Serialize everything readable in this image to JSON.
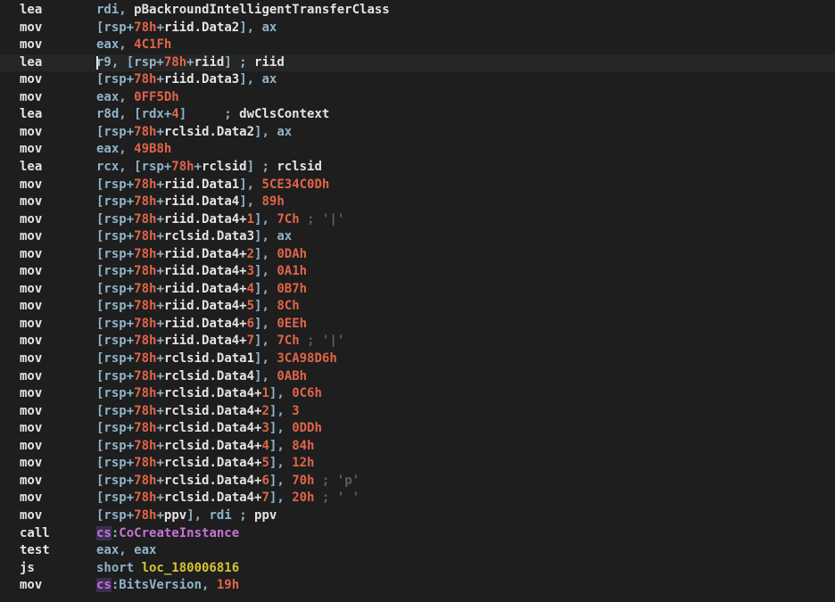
{
  "lines": [
    {
      "mnemonic": "lea",
      "tokens": [
        {
          "c": "plain",
          "t": "rdi, "
        },
        {
          "c": "white",
          "t": "pBackroundIntelligentTransferClass"
        }
      ]
    },
    {
      "mnemonic": "mov",
      "tokens": [
        {
          "c": "plain",
          "t": "[rsp+"
        },
        {
          "c": "num",
          "t": "78h"
        },
        {
          "c": "plain",
          "t": "+"
        },
        {
          "c": "white",
          "t": "riid.Data2"
        },
        {
          "c": "plain",
          "t": "], ax"
        }
      ]
    },
    {
      "mnemonic": "mov",
      "tokens": [
        {
          "c": "plain",
          "t": "eax, "
        },
        {
          "c": "num",
          "t": "4C1Fh"
        }
      ]
    },
    {
      "mnemonic": "lea",
      "active": true,
      "tokens": [
        {
          "c": "plain",
          "t": "r9, [rsp+"
        },
        {
          "c": "num",
          "t": "78h"
        },
        {
          "c": "plain",
          "t": "+"
        },
        {
          "c": "white",
          "t": "riid"
        },
        {
          "c": "plain",
          "t": "] ; "
        },
        {
          "c": "white",
          "t": "riid"
        }
      ]
    },
    {
      "mnemonic": "mov",
      "tokens": [
        {
          "c": "plain",
          "t": "[rsp+"
        },
        {
          "c": "num",
          "t": "78h"
        },
        {
          "c": "plain",
          "t": "+"
        },
        {
          "c": "white",
          "t": "riid.Data3"
        },
        {
          "c": "plain",
          "t": "], ax"
        }
      ]
    },
    {
      "mnemonic": "mov",
      "tokens": [
        {
          "c": "plain",
          "t": "eax, "
        },
        {
          "c": "num",
          "t": "0FF5Dh"
        }
      ]
    },
    {
      "mnemonic": "lea",
      "tokens": [
        {
          "c": "plain",
          "t": "r8d, [rdx+"
        },
        {
          "c": "num",
          "t": "4"
        },
        {
          "c": "plain",
          "t": "]     ; "
        },
        {
          "c": "white",
          "t": "dwClsContext"
        }
      ]
    },
    {
      "mnemonic": "mov",
      "tokens": [
        {
          "c": "plain",
          "t": "[rsp+"
        },
        {
          "c": "num",
          "t": "78h"
        },
        {
          "c": "plain",
          "t": "+"
        },
        {
          "c": "white",
          "t": "rclsid.Data2"
        },
        {
          "c": "plain",
          "t": "], ax"
        }
      ]
    },
    {
      "mnemonic": "mov",
      "tokens": [
        {
          "c": "plain",
          "t": "eax, "
        },
        {
          "c": "num",
          "t": "49B8h"
        }
      ]
    },
    {
      "mnemonic": "lea",
      "tokens": [
        {
          "c": "plain",
          "t": "rcx, [rsp+"
        },
        {
          "c": "num",
          "t": "78h"
        },
        {
          "c": "plain",
          "t": "+"
        },
        {
          "c": "white",
          "t": "rclsid"
        },
        {
          "c": "plain",
          "t": "] ; "
        },
        {
          "c": "white",
          "t": "rclsid"
        }
      ]
    },
    {
      "mnemonic": "mov",
      "tokens": [
        {
          "c": "plain",
          "t": "[rsp+"
        },
        {
          "c": "num",
          "t": "78h"
        },
        {
          "c": "plain",
          "t": "+"
        },
        {
          "c": "white",
          "t": "riid.Data1"
        },
        {
          "c": "plain",
          "t": "], "
        },
        {
          "c": "num",
          "t": "5CE34C0Dh"
        }
      ]
    },
    {
      "mnemonic": "mov",
      "tokens": [
        {
          "c": "plain",
          "t": "[rsp+"
        },
        {
          "c": "num",
          "t": "78h"
        },
        {
          "c": "plain",
          "t": "+"
        },
        {
          "c": "white",
          "t": "riid.Data4"
        },
        {
          "c": "plain",
          "t": "], "
        },
        {
          "c": "num",
          "t": "89h"
        }
      ]
    },
    {
      "mnemonic": "mov",
      "tokens": [
        {
          "c": "plain",
          "t": "[rsp+"
        },
        {
          "c": "num",
          "t": "78h"
        },
        {
          "c": "plain",
          "t": "+"
        },
        {
          "c": "white",
          "t": "riid.Data4+"
        },
        {
          "c": "num",
          "t": "1"
        },
        {
          "c": "plain",
          "t": "], "
        },
        {
          "c": "num",
          "t": "7Ch"
        },
        {
          "c": "cmt",
          "t": " ; '|'"
        }
      ]
    },
    {
      "mnemonic": "mov",
      "tokens": [
        {
          "c": "plain",
          "t": "[rsp+"
        },
        {
          "c": "num",
          "t": "78h"
        },
        {
          "c": "plain",
          "t": "+"
        },
        {
          "c": "white",
          "t": "rclsid.Data3"
        },
        {
          "c": "plain",
          "t": "], ax"
        }
      ]
    },
    {
      "mnemonic": "mov",
      "tokens": [
        {
          "c": "plain",
          "t": "[rsp+"
        },
        {
          "c": "num",
          "t": "78h"
        },
        {
          "c": "plain",
          "t": "+"
        },
        {
          "c": "white",
          "t": "riid.Data4+"
        },
        {
          "c": "num",
          "t": "2"
        },
        {
          "c": "plain",
          "t": "], "
        },
        {
          "c": "num",
          "t": "0DAh"
        }
      ]
    },
    {
      "mnemonic": "mov",
      "tokens": [
        {
          "c": "plain",
          "t": "[rsp+"
        },
        {
          "c": "num",
          "t": "78h"
        },
        {
          "c": "plain",
          "t": "+"
        },
        {
          "c": "white",
          "t": "riid.Data4+"
        },
        {
          "c": "num",
          "t": "3"
        },
        {
          "c": "plain",
          "t": "], "
        },
        {
          "c": "num",
          "t": "0A1h"
        }
      ]
    },
    {
      "mnemonic": "mov",
      "tokens": [
        {
          "c": "plain",
          "t": "[rsp+"
        },
        {
          "c": "num",
          "t": "78h"
        },
        {
          "c": "plain",
          "t": "+"
        },
        {
          "c": "white",
          "t": "riid.Data4+"
        },
        {
          "c": "num",
          "t": "4"
        },
        {
          "c": "plain",
          "t": "], "
        },
        {
          "c": "num",
          "t": "0B7h"
        }
      ]
    },
    {
      "mnemonic": "mov",
      "tokens": [
        {
          "c": "plain",
          "t": "[rsp+"
        },
        {
          "c": "num",
          "t": "78h"
        },
        {
          "c": "plain",
          "t": "+"
        },
        {
          "c": "white",
          "t": "riid.Data4+"
        },
        {
          "c": "num",
          "t": "5"
        },
        {
          "c": "plain",
          "t": "], "
        },
        {
          "c": "num",
          "t": "8Ch"
        }
      ]
    },
    {
      "mnemonic": "mov",
      "tokens": [
        {
          "c": "plain",
          "t": "[rsp+"
        },
        {
          "c": "num",
          "t": "78h"
        },
        {
          "c": "plain",
          "t": "+"
        },
        {
          "c": "white",
          "t": "riid.Data4+"
        },
        {
          "c": "num",
          "t": "6"
        },
        {
          "c": "plain",
          "t": "], "
        },
        {
          "c": "num",
          "t": "0EEh"
        }
      ]
    },
    {
      "mnemonic": "mov",
      "tokens": [
        {
          "c": "plain",
          "t": "[rsp+"
        },
        {
          "c": "num",
          "t": "78h"
        },
        {
          "c": "plain",
          "t": "+"
        },
        {
          "c": "white",
          "t": "riid.Data4+"
        },
        {
          "c": "num",
          "t": "7"
        },
        {
          "c": "plain",
          "t": "], "
        },
        {
          "c": "num",
          "t": "7Ch"
        },
        {
          "c": "cmt",
          "t": " ; '|'"
        }
      ]
    },
    {
      "mnemonic": "mov",
      "tokens": [
        {
          "c": "plain",
          "t": "[rsp+"
        },
        {
          "c": "num",
          "t": "78h"
        },
        {
          "c": "plain",
          "t": "+"
        },
        {
          "c": "white",
          "t": "rclsid.Data1"
        },
        {
          "c": "plain",
          "t": "], "
        },
        {
          "c": "num",
          "t": "3CA98D6h"
        }
      ]
    },
    {
      "mnemonic": "mov",
      "tokens": [
        {
          "c": "plain",
          "t": "[rsp+"
        },
        {
          "c": "num",
          "t": "78h"
        },
        {
          "c": "plain",
          "t": "+"
        },
        {
          "c": "white",
          "t": "rclsid.Data4"
        },
        {
          "c": "plain",
          "t": "], "
        },
        {
          "c": "num",
          "t": "0ABh"
        }
      ]
    },
    {
      "mnemonic": "mov",
      "tokens": [
        {
          "c": "plain",
          "t": "[rsp+"
        },
        {
          "c": "num",
          "t": "78h"
        },
        {
          "c": "plain",
          "t": "+"
        },
        {
          "c": "white",
          "t": "rclsid.Data4+"
        },
        {
          "c": "num",
          "t": "1"
        },
        {
          "c": "plain",
          "t": "], "
        },
        {
          "c": "num",
          "t": "0C6h"
        }
      ]
    },
    {
      "mnemonic": "mov",
      "tokens": [
        {
          "c": "plain",
          "t": "[rsp+"
        },
        {
          "c": "num",
          "t": "78h"
        },
        {
          "c": "plain",
          "t": "+"
        },
        {
          "c": "white",
          "t": "rclsid.Data4+"
        },
        {
          "c": "num",
          "t": "2"
        },
        {
          "c": "plain",
          "t": "], "
        },
        {
          "c": "num",
          "t": "3"
        }
      ]
    },
    {
      "mnemonic": "mov",
      "tokens": [
        {
          "c": "plain",
          "t": "[rsp+"
        },
        {
          "c": "num",
          "t": "78h"
        },
        {
          "c": "plain",
          "t": "+"
        },
        {
          "c": "white",
          "t": "rclsid.Data4+"
        },
        {
          "c": "num",
          "t": "3"
        },
        {
          "c": "plain",
          "t": "], "
        },
        {
          "c": "num",
          "t": "0DDh"
        }
      ]
    },
    {
      "mnemonic": "mov",
      "tokens": [
        {
          "c": "plain",
          "t": "[rsp+"
        },
        {
          "c": "num",
          "t": "78h"
        },
        {
          "c": "plain",
          "t": "+"
        },
        {
          "c": "white",
          "t": "rclsid.Data4+"
        },
        {
          "c": "num",
          "t": "4"
        },
        {
          "c": "plain",
          "t": "], "
        },
        {
          "c": "num",
          "t": "84h"
        }
      ]
    },
    {
      "mnemonic": "mov",
      "tokens": [
        {
          "c": "plain",
          "t": "[rsp+"
        },
        {
          "c": "num",
          "t": "78h"
        },
        {
          "c": "plain",
          "t": "+"
        },
        {
          "c": "white",
          "t": "rclsid.Data4+"
        },
        {
          "c": "num",
          "t": "5"
        },
        {
          "c": "plain",
          "t": "], "
        },
        {
          "c": "num",
          "t": "12h"
        }
      ]
    },
    {
      "mnemonic": "mov",
      "tokens": [
        {
          "c": "plain",
          "t": "[rsp+"
        },
        {
          "c": "num",
          "t": "78h"
        },
        {
          "c": "plain",
          "t": "+"
        },
        {
          "c": "white",
          "t": "rclsid.Data4+"
        },
        {
          "c": "num",
          "t": "6"
        },
        {
          "c": "plain",
          "t": "], "
        },
        {
          "c": "num",
          "t": "70h"
        },
        {
          "c": "cmt",
          "t": " ; 'p'"
        }
      ]
    },
    {
      "mnemonic": "mov",
      "tokens": [
        {
          "c": "plain",
          "t": "[rsp+"
        },
        {
          "c": "num",
          "t": "78h"
        },
        {
          "c": "plain",
          "t": "+"
        },
        {
          "c": "white",
          "t": "rclsid.Data4+"
        },
        {
          "c": "num",
          "t": "7"
        },
        {
          "c": "plain",
          "t": "], "
        },
        {
          "c": "num",
          "t": "20h"
        },
        {
          "c": "cmt",
          "t": " ; ' '"
        }
      ]
    },
    {
      "mnemonic": "mov",
      "tokens": [
        {
          "c": "plain",
          "t": "[rsp+"
        },
        {
          "c": "num",
          "t": "78h"
        },
        {
          "c": "plain",
          "t": "+"
        },
        {
          "c": "white",
          "t": "ppv"
        },
        {
          "c": "plain",
          "t": "], rdi ; "
        },
        {
          "c": "white",
          "t": "ppv"
        }
      ]
    },
    {
      "mnemonic": "call",
      "tokens": [
        {
          "c": "seg",
          "t": "cs"
        },
        {
          "c": "plain",
          "t": ":"
        },
        {
          "c": "func",
          "t": "CoCreateInstance"
        }
      ]
    },
    {
      "mnemonic": "test",
      "tokens": [
        {
          "c": "plain",
          "t": "eax, eax"
        }
      ]
    },
    {
      "mnemonic": "js",
      "tokens": [
        {
          "c": "plain",
          "t": "short "
        },
        {
          "c": "label",
          "t": "loc_180006816"
        }
      ]
    },
    {
      "mnemonic": "mov",
      "tokens": [
        {
          "c": "seg",
          "t": "cs"
        },
        {
          "c": "plain",
          "t": ":BitsVersion, "
        },
        {
          "c": "num",
          "t": "19h"
        }
      ]
    }
  ]
}
